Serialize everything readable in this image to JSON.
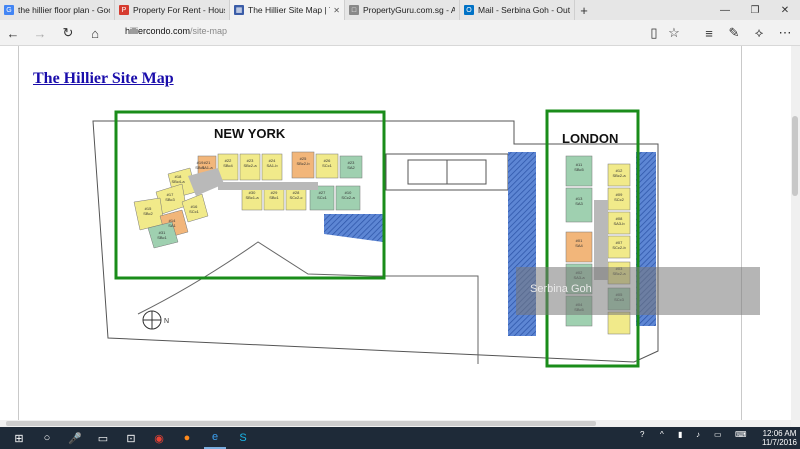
{
  "tabs": [
    {
      "title": "the hillier floor plan - Goog",
      "icon": "google-icon",
      "color": "#4285f4",
      "glyph": "G"
    },
    {
      "title": "Property For Rent - Houses",
      "icon": "propertyguru-icon",
      "color": "#d63b2f",
      "glyph": "P"
    },
    {
      "title": "The Hillier Site Map | Th",
      "icon": "page-icon",
      "color": "#3b5da8",
      "glyph": "▦"
    },
    {
      "title": "PropertyGuru.com.sg - Ager",
      "icon": "page-icon",
      "color": "#888888",
      "glyph": "□"
    },
    {
      "title": "Mail - Serbina Goh - Outloc",
      "icon": "outlook-icon",
      "color": "#0072c6",
      "glyph": "O"
    }
  ],
  "new_tab_glyph": "+",
  "address": {
    "domain": "hilliercondo.com",
    "path": "/site-map"
  },
  "page": {
    "title": "The Hillier Site Map",
    "map": {
      "new_york_label": "NEW YORK",
      "london_label": "LONDON",
      "units": [
        {
          "id": "#21",
          "type": "SA1-a"
        },
        {
          "id": "#22",
          "type": "SBc4"
        },
        {
          "id": "#23",
          "type": "SBc2-a"
        },
        {
          "id": "#24",
          "type": "SA1-b"
        },
        {
          "id": "#25",
          "type": "SBc2-b"
        },
        {
          "id": "#26",
          "type": "SCc1"
        },
        {
          "id": "#23",
          "type": "SA2"
        },
        {
          "id": "#19",
          "type": "SBc1"
        },
        {
          "id": "#18",
          "type": "SBc4-a"
        },
        {
          "id": "#17",
          "type": "SBc3"
        },
        {
          "id": "#15",
          "type": "SBc2"
        },
        {
          "id": "#14",
          "type": "SA1"
        },
        {
          "id": "#16",
          "type": "SCc1"
        },
        {
          "id": "#31",
          "type": "SBc1"
        },
        {
          "id": "#30",
          "type": "SBc1-a"
        },
        {
          "id": "#29",
          "type": "SBc1"
        },
        {
          "id": "#28",
          "type": "SCc2-c"
        },
        {
          "id": "#27",
          "type": "SCc1"
        },
        {
          "id": "#10",
          "type": "SCc2-a"
        },
        {
          "id": "#11",
          "type": "SBc5"
        },
        {
          "id": "#12",
          "type": "SBc2-a"
        },
        {
          "id": "#09",
          "type": "SCc2"
        },
        {
          "id": "#13",
          "type": "SA3"
        },
        {
          "id": "#08",
          "type": "SA3-b"
        },
        {
          "id": "#01",
          "type": "SA4"
        },
        {
          "id": "#07",
          "type": "SCc2-b"
        },
        {
          "id": "#02",
          "type": "SA3-a"
        },
        {
          "id": "#03",
          "type": "SBc2-a"
        },
        {
          "id": "#05",
          "type": "SCc3"
        },
        {
          "id": "#04",
          "type": "SBc5"
        }
      ]
    },
    "watermark": "Serbina Goh"
  },
  "taskbar": {
    "time": "12:06 AM",
    "date": "11/7/2016"
  },
  "colors": {
    "green_box": "#1a8c1a",
    "blue_hatch": "#3f6fc4",
    "yellow": "#f1ea8a",
    "orange": "#f2b67a",
    "teal": "#9fd0b0",
    "gray": "#b9b9b9"
  }
}
